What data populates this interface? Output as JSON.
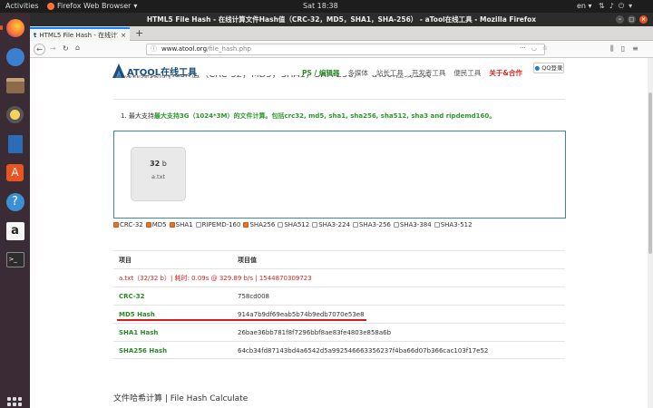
{
  "topbar": {
    "activities": "Activities",
    "app": "Firefox Web Browser",
    "clock": "Sat 18:38",
    "lang": "en"
  },
  "window": {
    "title": "HTML5 File Hash - 在线计算文件Hash值（CRC-32，MD5，SHA1，SHA-256） - aTool在线工具 - Mozilla Firefox"
  },
  "tab": {
    "title": "HTML5 File Hash - 在线计算"
  },
  "urlbar": {
    "host": "www.atool.org",
    "path": "/file_hash.php"
  },
  "site": {
    "logo": "ATOOL在线工具",
    "logo_sub": "www.atool.org",
    "nav": [
      "PS / 编辑器",
      "多媒体",
      "站长工具",
      "开发者工具",
      "便民工具",
      "关于&合作"
    ],
    "qq_login": "QQ登录"
  },
  "page": {
    "title_partial": "在线计算文件Hash值（CRC-32，MD5，SHA1，SHA-256） - aTool在线工具",
    "note_prefix": "1. 最大支持",
    "note_green": "最大支持3G（1024*3M）的文件计算。包括crc32, md5, sha1, sha256, sha512, sha3 and ripdemd160。",
    "bottom_title": "文件哈希计算 | File Hash Calculate"
  },
  "file": {
    "size_num": "32",
    "size_unit": " b",
    "name": "a.txt"
  },
  "checkboxes": [
    {
      "label": "CRC-32",
      "checked": true
    },
    {
      "label": "MD5",
      "checked": true
    },
    {
      "label": "SHA1",
      "checked": true
    },
    {
      "label": "RIPEMD-160",
      "checked": false
    },
    {
      "label": "SHA256",
      "checked": true
    },
    {
      "label": "SHA512",
      "checked": false
    },
    {
      "label": "SHA3-224",
      "checked": false
    },
    {
      "label": "SHA3-256",
      "checked": false
    },
    {
      "label": "SHA3-384",
      "checked": false
    },
    {
      "label": "SHA3-512",
      "checked": false
    }
  ],
  "table": {
    "header": {
      "item": "项目",
      "value": "项目值"
    },
    "meta": "a.txt（32/32 b）| 耗时: 0.09s @ 329.89 b/s | 1544870309723",
    "rows": [
      {
        "algo": "CRC-32",
        "value": "758cd008"
      },
      {
        "algo": "MD5 Hash",
        "value": "914a7b9df69eab5b74b9edb7070e53e8"
      },
      {
        "algo": "SHA1 Hash",
        "value": "26bae36bb781f8f7296bbf8ae83fe4803e858a6b"
      },
      {
        "algo": "SHA256 Hash",
        "value": "64cb34fd87143bd4a6542d5a992546663356237f4ba66d07b366cac103f17e52"
      }
    ]
  },
  "colors": {
    "accent_orange": "#e95420",
    "green": "#2a8a2a",
    "red": "#d0261d",
    "dropbox_border": "#3a8a94"
  }
}
